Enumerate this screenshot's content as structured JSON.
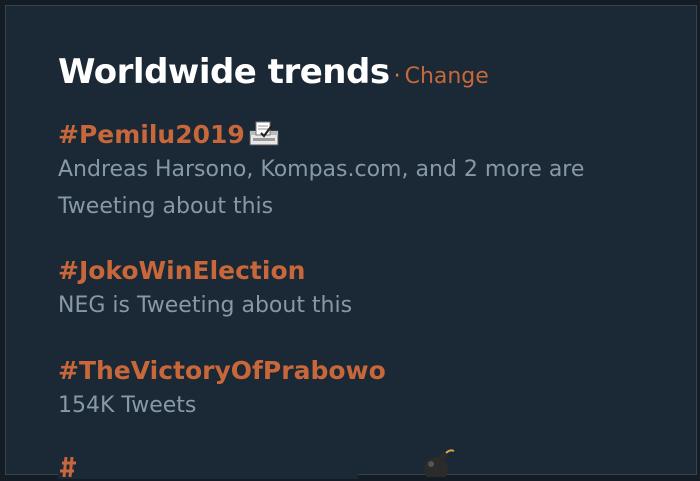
{
  "header": {
    "title": "Worldwide trends",
    "separator": "·",
    "change_label": "Change"
  },
  "trends": [
    {
      "hashtag": "#Pemilu2019",
      "desc_line1": "Andreas Harsono, Kompas.com, and 2 more are",
      "desc_line2": "Tweeting about this"
    },
    {
      "hashtag": "#JokoWinElection",
      "desc_line1": "NEG is Tweeting about this"
    },
    {
      "hashtag": "#TheVictoryOfPrabowo",
      "desc_line1": "154K Tweets"
    }
  ],
  "icons": {
    "ballot_box": "ballot-box-icon",
    "bomb": "bomb-icon"
  },
  "colors": {
    "background": "#1b2836",
    "accent": "#c8673a",
    "secondary_text": "#8899a6",
    "title": "#ffffff"
  }
}
